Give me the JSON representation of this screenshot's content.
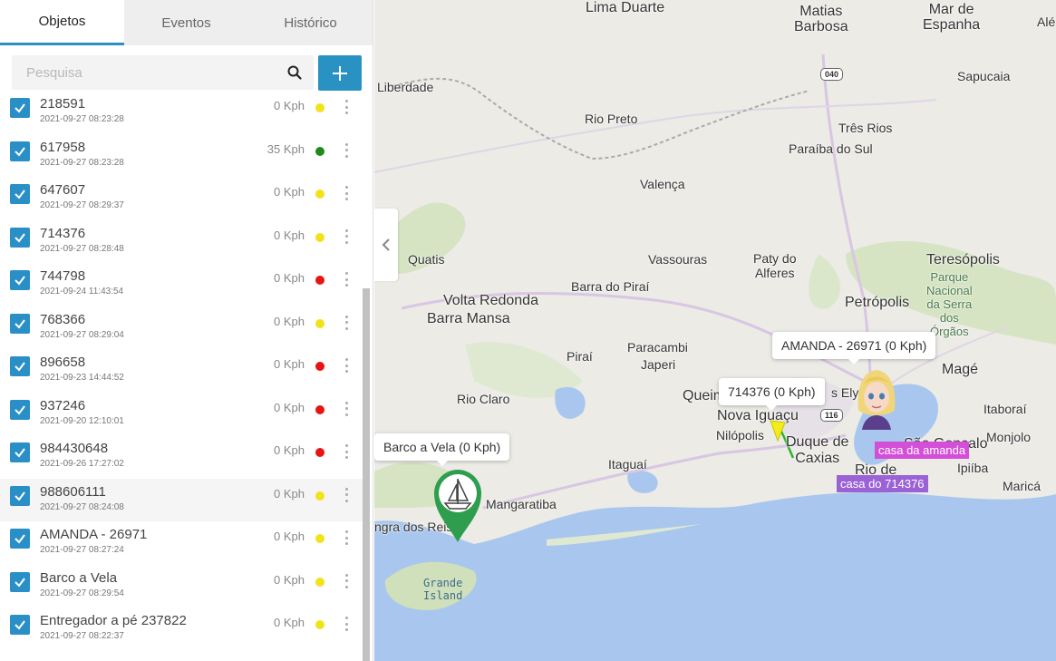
{
  "tabs": [
    {
      "label": "Objetos",
      "active": true
    },
    {
      "label": "Eventos",
      "active": false
    },
    {
      "label": "Histórico",
      "active": false
    }
  ],
  "search": {
    "placeholder": "Pesquisa",
    "value": ""
  },
  "objects": [
    {
      "name": "218591",
      "time": "2021-09-27 08:23:28",
      "speed": "0 Kph",
      "status_color": "#f0e31a",
      "checked": true
    },
    {
      "name": "617958",
      "time": "2021-09-27 08:23:28",
      "speed": "35 Kph",
      "status_color": "#1e8a1e",
      "checked": true
    },
    {
      "name": "647607",
      "time": "2021-09-27 08:29:37",
      "speed": "0 Kph",
      "status_color": "#f0e31a",
      "checked": true
    },
    {
      "name": "714376",
      "time": "2021-09-27 08:28:48",
      "speed": "0 Kph",
      "status_color": "#f0e31a",
      "checked": true
    },
    {
      "name": "744798",
      "time": "2021-09-24 11:43:54",
      "speed": "0 Kph",
      "status_color": "#e81414",
      "checked": true
    },
    {
      "name": "768366",
      "time": "2021-09-27 08:29:04",
      "speed": "0 Kph",
      "status_color": "#f0e31a",
      "checked": true
    },
    {
      "name": "896658",
      "time": "2021-09-23 14:44:52",
      "speed": "0 Kph",
      "status_color": "#e81414",
      "checked": true
    },
    {
      "name": "937246",
      "time": "2021-09-20 12:10:01",
      "speed": "0 Kph",
      "status_color": "#e81414",
      "checked": true
    },
    {
      "name": "984430648",
      "time": "2021-09-26 17:27:02",
      "speed": "0 Kph",
      "status_color": "#e81414",
      "checked": true
    },
    {
      "name": "988606111",
      "time": "2021-09-27 08:24:08",
      "speed": "0 Kph",
      "status_color": "#f0e31a",
      "checked": true,
      "highlighted": true
    },
    {
      "name": "AMANDA - 26971",
      "time": "2021-09-27 08:27:24",
      "speed": "0 Kph",
      "status_color": "#f0e31a",
      "checked": true
    },
    {
      "name": "Barco a Vela",
      "time": "2021-09-27 08:29:54",
      "speed": "0 Kph",
      "status_color": "#f0e31a",
      "checked": true
    },
    {
      "name": "Entregador a pé 237822",
      "time": "2021-09-27 08:22:37",
      "speed": "0 Kph",
      "status_color": "#f0e31a",
      "checked": true
    }
  ],
  "map": {
    "labels": {
      "lima_duarte": "Lima Duarte",
      "matias_barbosa": "Matias\nBarbosa",
      "mar_de_espanha": "Mar de\nEspanha",
      "ale": "Alé",
      "liberdade": "Liberdade",
      "sapucaia": "Sapucaia",
      "rio_preto": "Rio Preto",
      "tres_rios": "Três Rios",
      "paraiba_do_sul": "Paraíba do Sul",
      "valenca": "Valença",
      "quatis": "Quatis",
      "vassouras": "Vassouras",
      "paty_do_alferes": "Paty do\nAlferes",
      "teresopolis": "Teresópolis",
      "parque_nacional": "Parque\nNacional\nda Serra\ndos\nÓrgãos",
      "volta_redonda": "Volta Redonda",
      "barra_mansa": "Barra Mansa",
      "barra_do_pirai": "Barra do Piraí",
      "petropolis": "Petrópolis",
      "pirai": "Piraí",
      "paracambi": "Paracambi",
      "japeri": "Japeri",
      "mage": "Magé",
      "rio_claro": "Rio Claro",
      "queimados": "Queim",
      "nova_iguacu": "Nova Iguaçu",
      "nilopolis": "Nilópolis",
      "duque_de_caxias": "Duque de\nCaxias",
      "s_elyseos": "s Ely",
      "itaborai": "Itaboraí",
      "sao_goncalo": "São Gonçalo",
      "monjolo": "Monjolo",
      "ipiiba": "Ipiíba",
      "itaguai": "Itaguaí",
      "rio_de": "Rio de",
      "marica": "Maricá",
      "mangaratiba": "Mangaratiba",
      "angra_dos_reis": "ngra dos Reis",
      "grande_island": "Grande\nIsland"
    },
    "shields": {
      "road_040": "040",
      "road_116": "116"
    },
    "tooltips": {
      "amanda": "AMANDA - 26971 (0 Kph)",
      "tracker_714376": "714376 (0 Kph)",
      "barco": "Barco a Vela (0 Kph)"
    },
    "places": {
      "casa_amanda": "casa da amanda",
      "casa_714376": "casa do 714376"
    },
    "colors": {
      "land": "#ecebe6",
      "water": "#a9c7ee",
      "park": "#cfe0bb",
      "marker_green": "#2e9e4e",
      "place_magenta": "#d44fd8",
      "place_purple": "#9b62d6",
      "accent": "#2a92c2"
    }
  }
}
